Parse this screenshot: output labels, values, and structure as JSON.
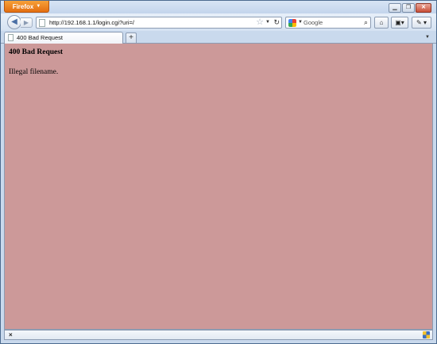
{
  "browser": {
    "menu_button_label": "Firefox",
    "window_controls": [
      "minimize",
      "restore",
      "close"
    ]
  },
  "navigation": {
    "url": "http://192.168.1.1/login.cgi?uri=/",
    "search_engine": "Google",
    "search_placeholder": "Google"
  },
  "tabs": [
    {
      "title": "400 Bad Request",
      "active": true
    }
  ],
  "page": {
    "heading": "400 Bad Request",
    "message": "Illegal filename.",
    "background_color": "#cc9999"
  },
  "statusbar": {
    "close_label": "×"
  }
}
